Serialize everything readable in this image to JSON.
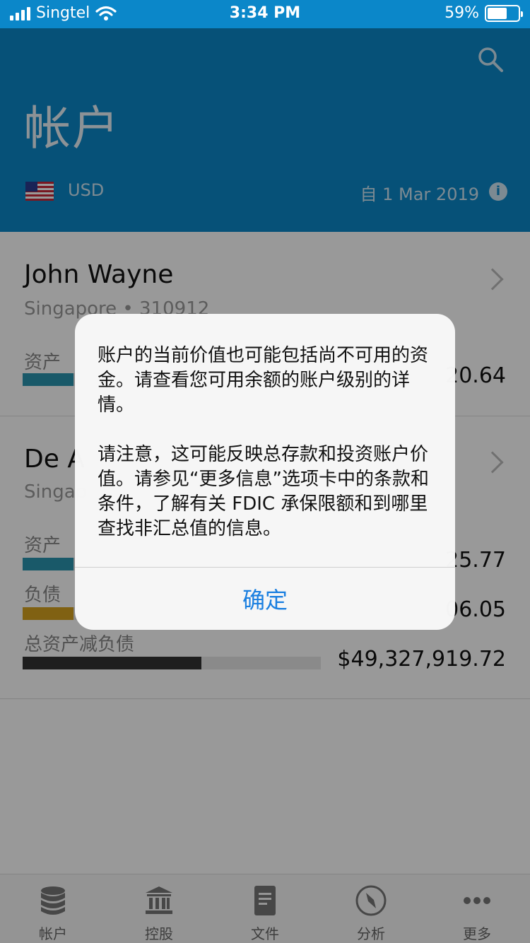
{
  "status_bar": {
    "carrier": "Singtel",
    "time": "3:34 PM",
    "battery": "59%",
    "battery_level": 0.59
  },
  "header": {
    "title": "帐户",
    "currency": "USD",
    "since": "自 1 Mar 2019",
    "info_glyph": "i",
    "accent_color": "#0b87c9"
  },
  "accounts": [
    {
      "name": "John Wayne",
      "location": "Singapore • 310912",
      "metrics": [
        {
          "label": "资产",
          "value": "20.64",
          "color": "#2a95b0",
          "fill": 0.17
        }
      ]
    },
    {
      "name": "De A",
      "location": "Singap",
      "metrics": [
        {
          "label": "资产",
          "value": "25.77",
          "color": "#2a95b0",
          "fill": 0.17
        },
        {
          "label": "负债",
          "value": "06.05",
          "color": "#d6a21e",
          "fill": 0.17
        },
        {
          "label": "总资产减负债",
          "value": "$49,327,919.72",
          "color": "#333333",
          "fill": 0.6
        }
      ]
    }
  ],
  "alert": {
    "paragraph1": "账户的当前价值也可能包括尚不可用的资金。请查看您可用余额的账户级别的详情。",
    "paragraph2": "请注意，这可能反映总存款和投资账户价值。请参见“更多信息”选项卡中的条款和条件，了解有关 FDIC 承保限额和到哪里查找非汇总值的信息。",
    "button": "确定"
  },
  "tabs": [
    {
      "label": "帐户",
      "icon": "database-icon"
    },
    {
      "label": "控股",
      "icon": "bank-icon"
    },
    {
      "label": "文件",
      "icon": "document-icon"
    },
    {
      "label": "分析",
      "icon": "compass-icon"
    },
    {
      "label": "更多",
      "icon": "more-icon"
    }
  ]
}
